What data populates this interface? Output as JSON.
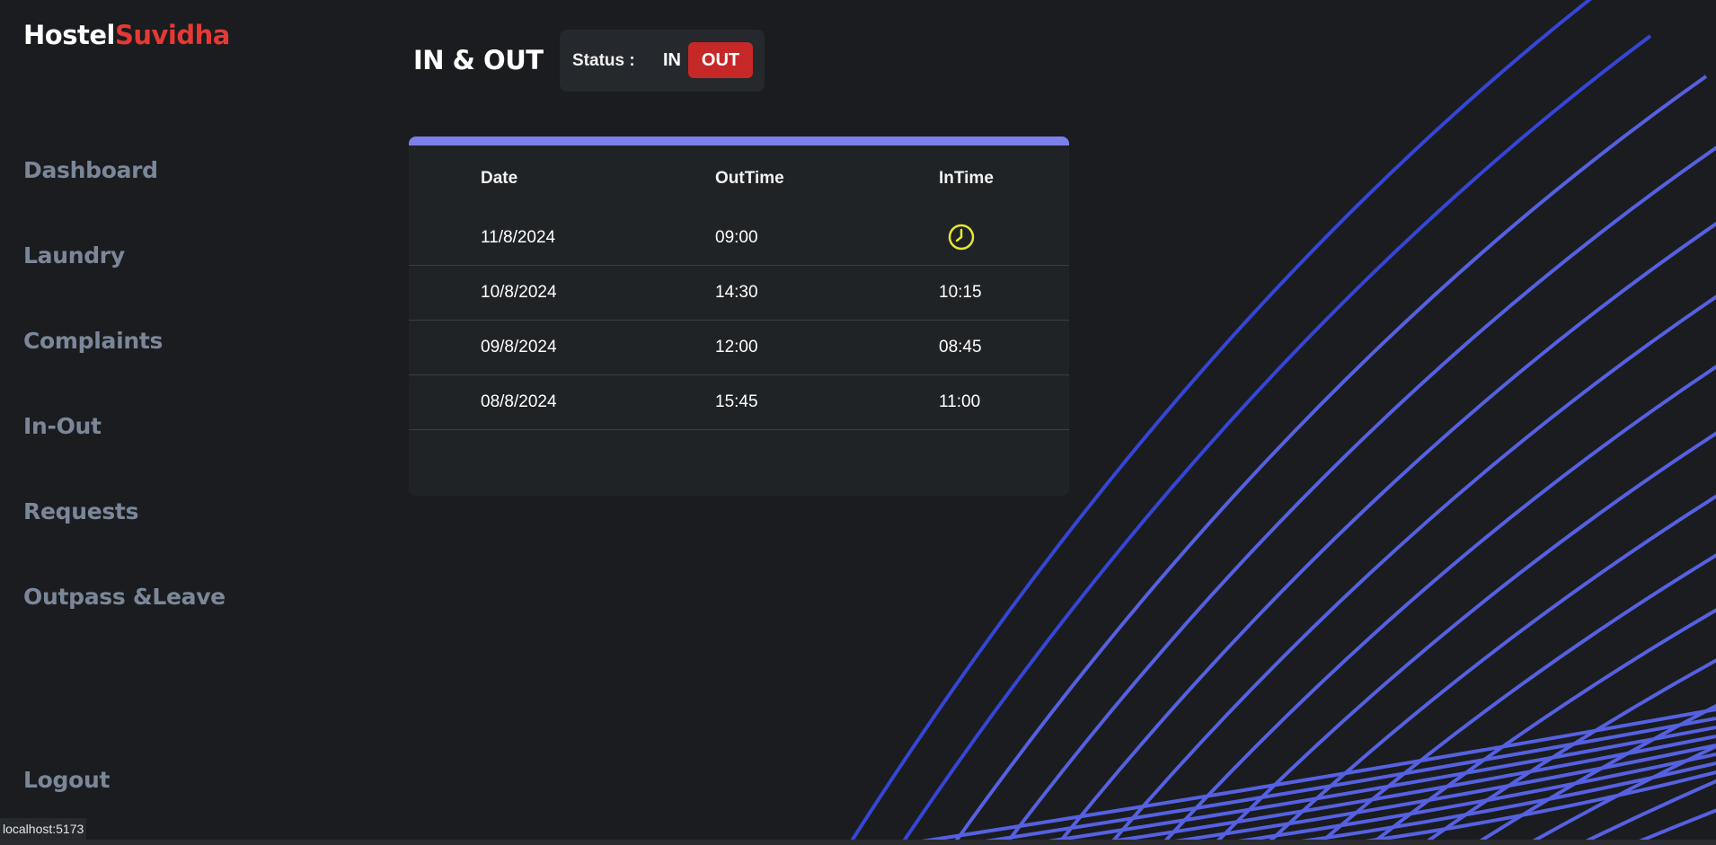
{
  "brand": {
    "part1": "Hostel",
    "part2": "Suvidha",
    "accent_color": "#e53935"
  },
  "sidebar": {
    "items": [
      {
        "label": "Dashboard"
      },
      {
        "label": "Laundry"
      },
      {
        "label": "Complaints"
      },
      {
        "label": "In-Out"
      },
      {
        "label": "Requests"
      },
      {
        "label": "Outpass &Leave"
      }
    ],
    "logout": "Logout"
  },
  "header": {
    "title": "IN & OUT",
    "status_label": "Status :",
    "in_label": "IN",
    "out_label": "OUT",
    "active_status": "OUT"
  },
  "table": {
    "columns": [
      "Date",
      "OutTime",
      "InTime"
    ],
    "rows": [
      {
        "date": "11/8/2024",
        "out": "09:00",
        "in": "",
        "in_icon": "clock-icon"
      },
      {
        "date": "10/8/2024",
        "out": "14:30",
        "in": "10:15"
      },
      {
        "date": "09/8/2024",
        "out": "12:00",
        "in": "08:45"
      },
      {
        "date": "08/8/2024",
        "out": "15:45",
        "in": "11:00"
      }
    ]
  },
  "statusbar": {
    "url": "localhost:5173"
  },
  "colors": {
    "out_button": "#c62828",
    "card_accent": "#7b80e8",
    "lines": "#5561e0",
    "clock": "#e6e635"
  }
}
